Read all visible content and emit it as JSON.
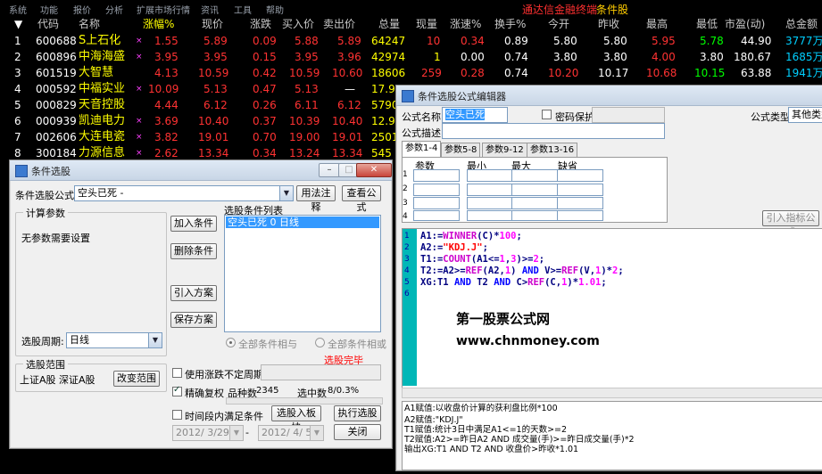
{
  "menubar": {
    "items": [
      "系统",
      "功能",
      "报价",
      "分析",
      "扩展市场行情",
      "资讯",
      "工具",
      "帮助"
    ],
    "brand": "通达信金融终端",
    "module": "条件股"
  },
  "table": {
    "headers": [
      "代码",
      "名称",
      "涨幅%",
      "现价",
      "涨跌",
      "买入价",
      "卖出价",
      "总量",
      "现量",
      "涨速%",
      "换手%",
      "今开",
      "昨收",
      "最高",
      "最低",
      "市盈(动)",
      "总金额"
    ],
    "rows": [
      {
        "idx": "1",
        "code": "600688",
        "name": "S上石化",
        "chg": "1.55",
        "price": "5.89",
        "diff": "0.09",
        "bid": "5.88",
        "ask": "5.89",
        "vol": "64247",
        "cur": "10",
        "speed": "0.34",
        "turn": "0.89",
        "open": "5.80",
        "prev": "5.80",
        "high": "5.95",
        "low": "5.78",
        "pe": "44.90",
        "amt": "3777万"
      },
      {
        "idx": "2",
        "code": "600896",
        "name": "中海海盛",
        "chg": "3.95",
        "price": "3.95",
        "diff": "0.15",
        "bid": "3.95",
        "ask": "3.96",
        "vol": "42974",
        "cur": "1",
        "speed": "0.00",
        "turn": "0.74",
        "open": "3.80",
        "prev": "3.80",
        "high": "4.00",
        "low": "3.80",
        "pe": "180.67",
        "amt": "1685万"
      },
      {
        "idx": "3",
        "code": "601519",
        "name": "大智慧",
        "chg": "4.13",
        "price": "10.59",
        "diff": "0.42",
        "bid": "10.59",
        "ask": "10.60",
        "vol": "18606",
        "cur": "259",
        "speed": "0.28",
        "turn": "0.74",
        "open": "10.20",
        "prev": "10.17",
        "high": "10.68",
        "low": "10.15",
        "pe": "63.88",
        "amt": "1941万"
      },
      {
        "idx": "4",
        "code": "000592",
        "name": "中福实业",
        "chg": "10.09",
        "price": "5.13",
        "diff": "0.47",
        "bid": "5.13",
        "ask": "—",
        "vol": "17.97",
        "cur": "",
        "speed": "",
        "turn": "",
        "open": "",
        "prev": "",
        "high": "",
        "low": "",
        "pe": "",
        "amt": ""
      },
      {
        "idx": "5",
        "code": "000829",
        "name": "天音控股",
        "chg": "4.44",
        "price": "6.12",
        "diff": "0.26",
        "bid": "6.11",
        "ask": "6.12",
        "vol": "5790",
        "cur": "",
        "speed": "",
        "turn": "",
        "open": "",
        "prev": "",
        "high": "",
        "low": "",
        "pe": "",
        "amt": ""
      },
      {
        "idx": "6",
        "code": "000939",
        "name": "凯迪电力",
        "chg": "3.69",
        "price": "10.40",
        "diff": "0.37",
        "bid": "10.39",
        "ask": "10.40",
        "vol": "12.97",
        "cur": "",
        "speed": "",
        "turn": "",
        "open": "",
        "prev": "",
        "high": "",
        "low": "",
        "pe": "",
        "amt": ""
      },
      {
        "idx": "7",
        "code": "002606",
        "name": "大连电瓷",
        "chg": "3.82",
        "price": "19.01",
        "diff": "0.70",
        "bid": "19.00",
        "ask": "19.01",
        "vol": "2501",
        "cur": "",
        "speed": "",
        "turn": "",
        "open": "",
        "prev": "",
        "high": "",
        "low": "",
        "pe": "",
        "amt": ""
      },
      {
        "idx": "8",
        "code": "300184",
        "name": "力源信息",
        "chg": "2.62",
        "price": "13.34",
        "diff": "0.34",
        "bid": "13.24",
        "ask": "13.34",
        "vol": "545",
        "cur": "",
        "speed": "",
        "turn": "",
        "open": "",
        "prev": "",
        "high": "",
        "low": "",
        "pe": "",
        "amt": ""
      }
    ]
  },
  "selector": {
    "title": "条件选股",
    "formula_label": "条件选股公式",
    "formula_value": "空头已死 -",
    "usage_btn": "用法注释",
    "view_btn": "查看公式",
    "params_group": "计算参数",
    "no_params": "无参数需要设置",
    "add_btn": "加入条件",
    "del_btn": "删除条件",
    "import_btn": "引入方案",
    "save_btn": "保存方案",
    "cond_list_label": "选股条件列表",
    "cond_item": "空头已死  0  日线",
    "period_label": "选股周期:",
    "period_value": "日线",
    "radio_and": "全部条件相与",
    "radio_or": "全部条件相或",
    "done_text": "选股完毕",
    "range_group": "选股范围",
    "range_value": "上证A股 深证A股",
    "change_range_btn": "改变范围",
    "use_cycle_chk": "使用涨跌不定周期",
    "precise_chk": "精确复权",
    "count_label": "品种数",
    "count_value": "2345",
    "hit_label": "选中数",
    "hit_value": "8/0.3%",
    "time_chk": "时间段内满足条件",
    "to_board_btn": "选股入板块",
    "run_btn": "执行选股",
    "close_btn": "关闭",
    "date_from": "2012/ 3/29",
    "date_sep": "-",
    "date_to": "2012/ 4/ 5"
  },
  "editor": {
    "title": "条件选股公式编辑器",
    "name_label": "公式名称",
    "name_value": "空头已死",
    "pwd_chk": "密码保护",
    "type_label": "公式类型",
    "type_value": "其他类型",
    "desc_label": "公式描述",
    "tabs": [
      "参数1-4",
      "参数5-8",
      "参数9-12",
      "参数13-16"
    ],
    "grid_headers": [
      "参数",
      "最小",
      "最大",
      "缺省"
    ],
    "grid_rows": [
      "1",
      "2",
      "3",
      "4"
    ],
    "import_indicator_btn": "引入指标公式",
    "code_lines": [
      "1",
      "2",
      "3",
      "4",
      "5",
      "6"
    ],
    "watermark1": "第一股票公式网",
    "watermark2": "www.chnmoney.com",
    "notes": [
      "A1赋值:以收盘价计算的获利盘比例*100",
      "A2赋值:\"KDJ.J\"",
      "T1赋值:统计3日中满足A1<=1的天数>=2",
      "T2赋值:A2>=昨日A2 AND 成交量(手)>=昨日成交量(手)*2",
      "输出XG:T1 AND T2 AND 收盘价>昨收*1.01"
    ]
  },
  "colors": {
    "up": "#ff3232",
    "flat": "#ffffff",
    "down": "#00ff00",
    "bg": "#000000",
    "header": "#c9c9c9"
  }
}
